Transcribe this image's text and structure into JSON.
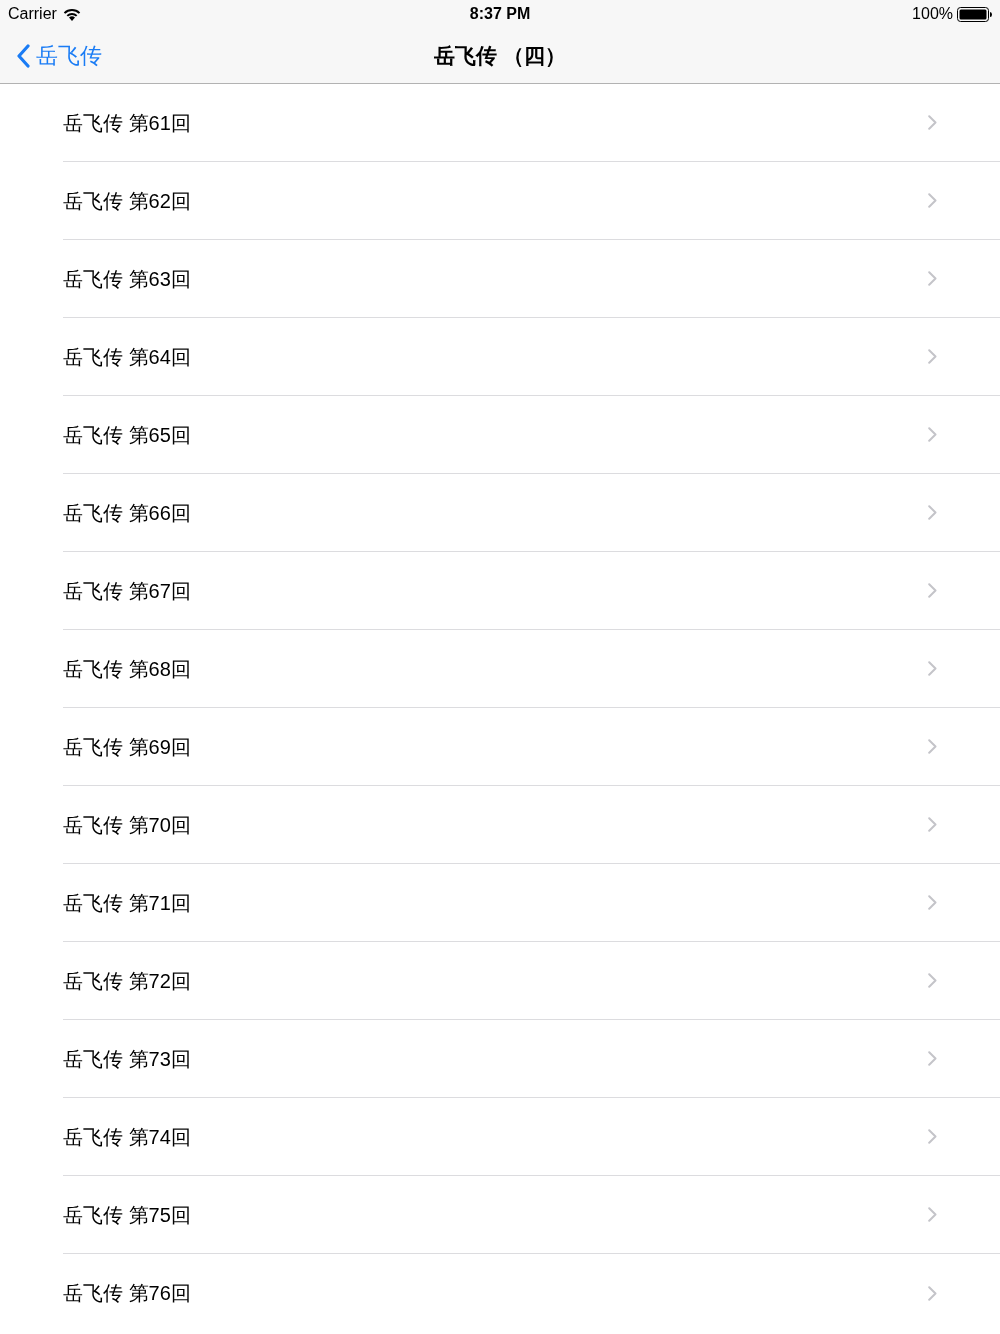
{
  "status_bar": {
    "carrier": "Carrier",
    "time": "8:37 PM",
    "battery": "100%"
  },
  "nav_bar": {
    "back": "岳飞传",
    "title": "岳飞传 （四）"
  },
  "rows": [
    {
      "label": "岳飞传 第61回"
    },
    {
      "label": "岳飞传 第62回"
    },
    {
      "label": "岳飞传 第63回"
    },
    {
      "label": "岳飞传 第64回"
    },
    {
      "label": "岳飞传 第65回"
    },
    {
      "label": "岳飞传 第66回"
    },
    {
      "label": "岳飞传 第67回"
    },
    {
      "label": "岳飞传 第68回"
    },
    {
      "label": "岳飞传 第69回"
    },
    {
      "label": "岳飞传 第70回"
    },
    {
      "label": "岳飞传 第71回"
    },
    {
      "label": "岳飞传 第72回"
    },
    {
      "label": "岳飞传 第73回"
    },
    {
      "label": "岳飞传 第74回"
    },
    {
      "label": "岳飞传 第75回"
    },
    {
      "label": "岳飞传 第76回"
    }
  ]
}
